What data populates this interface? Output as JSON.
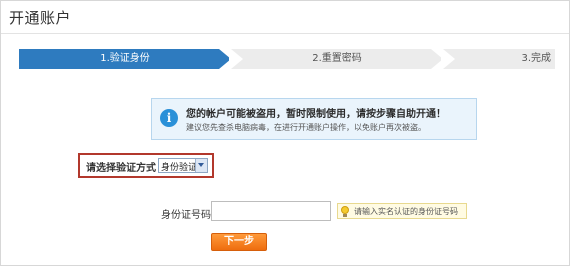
{
  "page": {
    "title": "开通账户"
  },
  "steps": [
    {
      "label": "1.验证身份",
      "state": "active"
    },
    {
      "label": "2.重置密码",
      "state": "inactive"
    },
    {
      "label": "3.完成",
      "state": "inactive"
    }
  ],
  "notice": {
    "icon": "info-icon",
    "main": "您的帐户可能被盗用，暂时限制使用，请按步骤自助开通！",
    "sub": "建议您先查杀电脑病毒，在进行开通账户操作，以免账户再次被盗。"
  },
  "method": {
    "label": "请选择验证方式",
    "selected": "身份验证"
  },
  "id_field": {
    "label": "身份证号码",
    "value": "",
    "hint": "请输入实名认证的身份证号码"
  },
  "actions": {
    "next_label": "下一步"
  },
  "colors": {
    "active_step": "#2e7bbf",
    "inactive_step": "#ececec",
    "highlight_border": "#b2382c",
    "button": "#f07d1a"
  }
}
